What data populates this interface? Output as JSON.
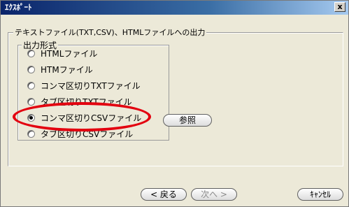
{
  "window": {
    "title": "ｴｸｽﾎﾟｰﾄ",
    "close_label": "x"
  },
  "export_group": {
    "legend": "テキストファイル(TXT,CSV)、HTMLファイルへの出力"
  },
  "format_group": {
    "legend": "出力形式",
    "options": [
      {
        "label": "HTMLファイル",
        "checked": false
      },
      {
        "label": "HTMファイル",
        "checked": false
      },
      {
        "label": "コンマ区切りTXTファイル",
        "checked": false
      },
      {
        "label": "タブ区切りTXTファイル",
        "checked": false
      },
      {
        "label": "コンマ区切りCSVファイル",
        "checked": true
      },
      {
        "label": "タブ区切りCSVファイル",
        "checked": false
      }
    ]
  },
  "buttons": {
    "browse": "参照",
    "back": "< 戻る",
    "next": "次へ >",
    "cancel": "ｷｬﾝｾﾙ"
  },
  "highlight_color": "#e3000f"
}
